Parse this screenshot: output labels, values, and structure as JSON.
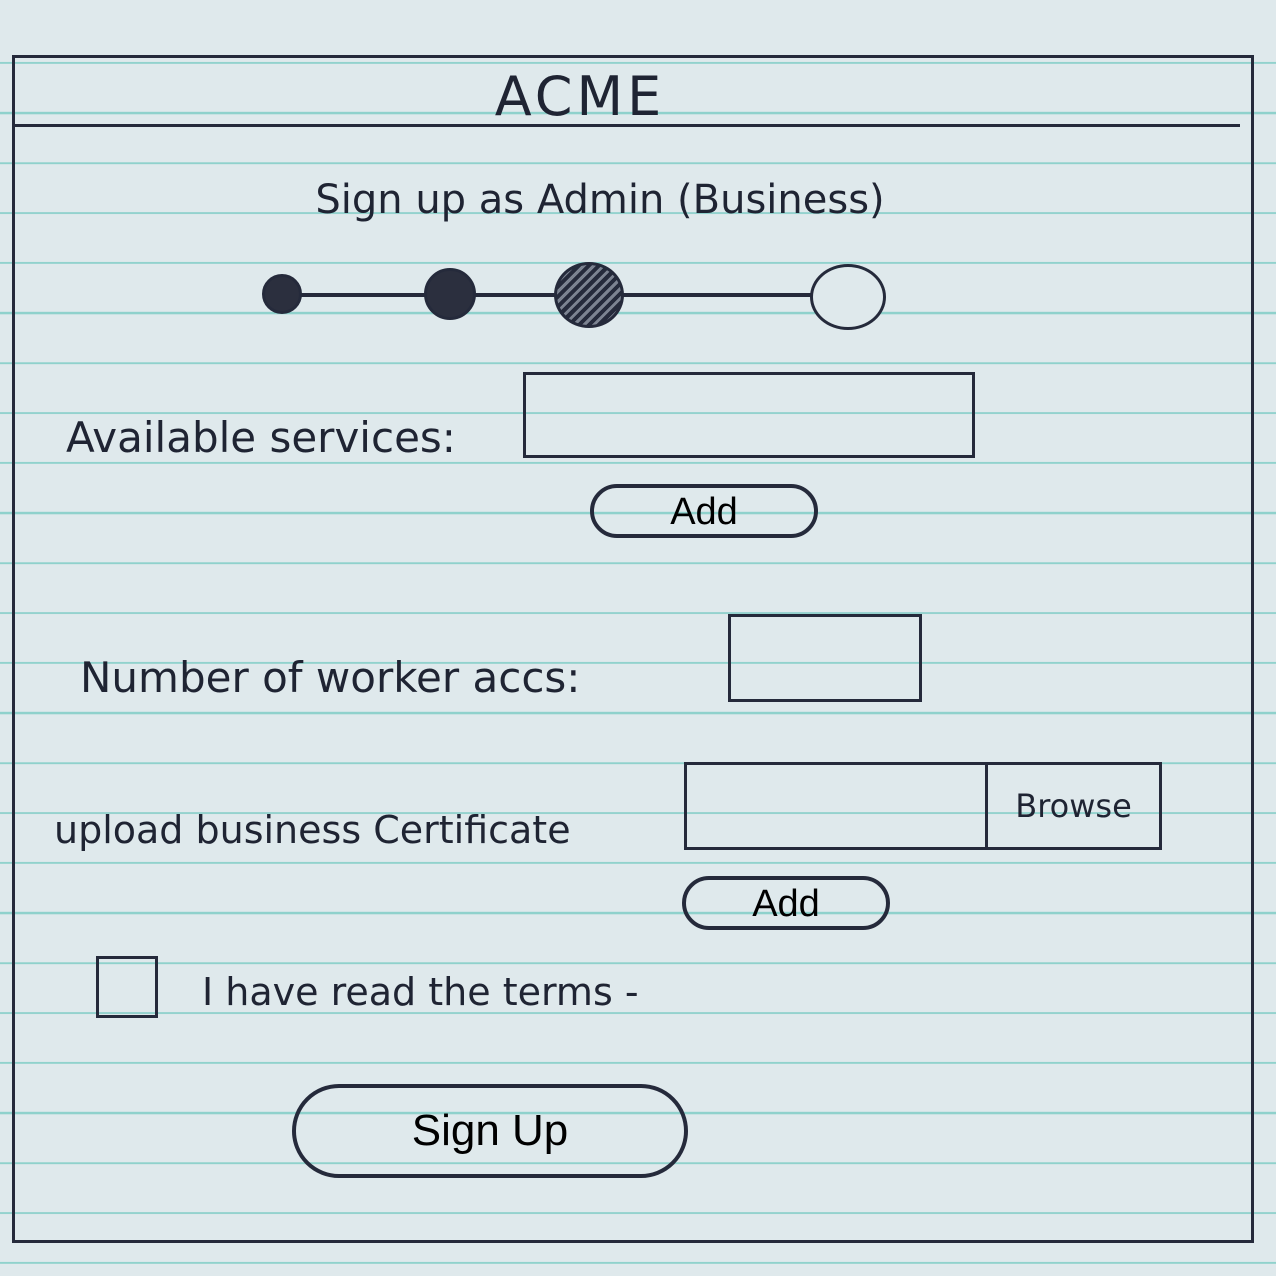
{
  "app": {
    "title": "ACME"
  },
  "page": {
    "heading": "Sign up as Admin (Business)"
  },
  "stepper": {
    "total_steps": 4,
    "current_step": 3
  },
  "services": {
    "label": "Available services:",
    "value": "",
    "add_label": "Add"
  },
  "workers": {
    "label": "Number of worker accs:",
    "value": ""
  },
  "certificate": {
    "label": "upload business Certificate",
    "value": "",
    "browse_label": "Browse",
    "add_label": "Add"
  },
  "terms": {
    "label": "I have read the terms -",
    "checked": false
  },
  "submit": {
    "label": "Sign Up"
  }
}
